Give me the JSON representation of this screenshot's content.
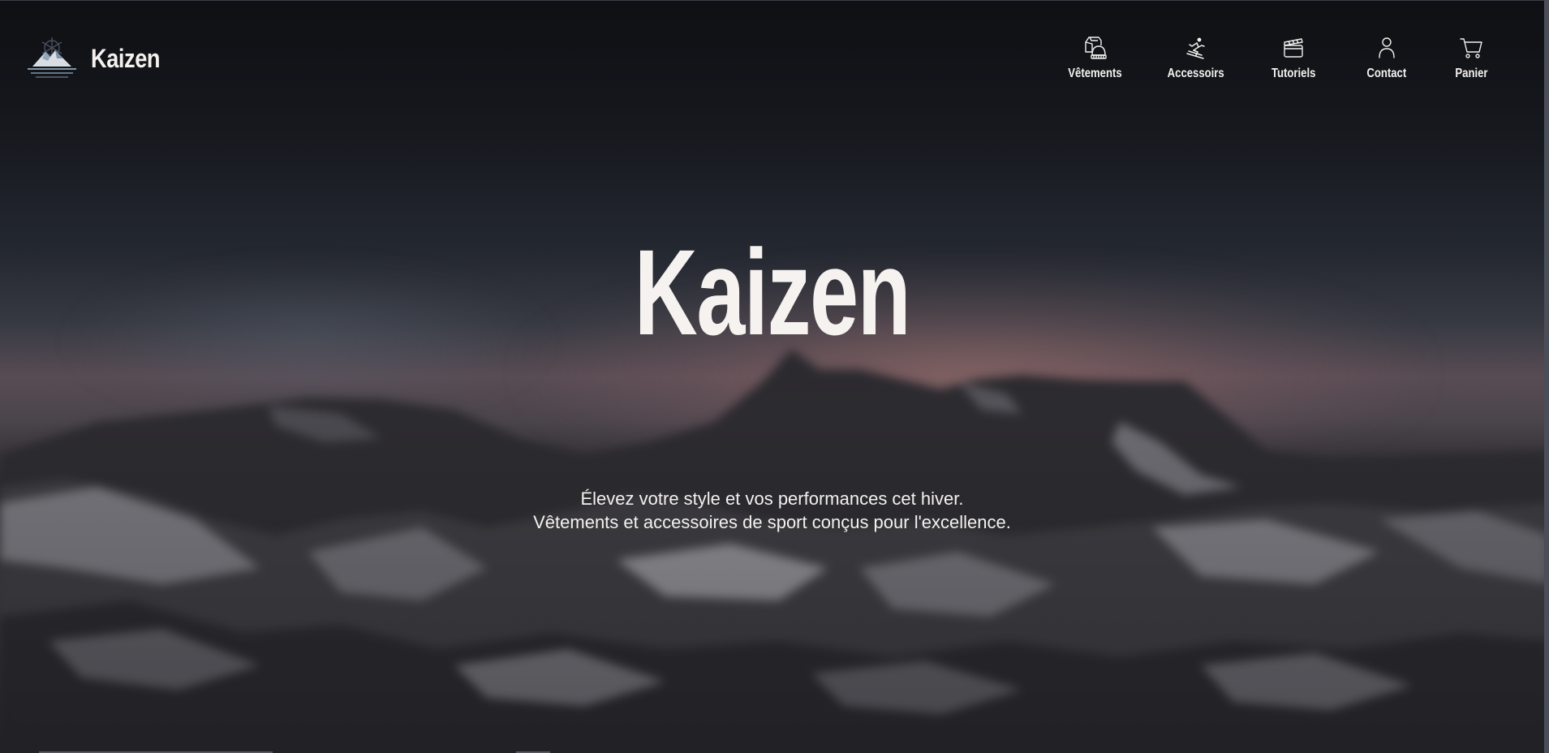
{
  "header": {
    "brand_name": "Kaizen",
    "logo_icon": "mountain-snowflake-logo",
    "nav": [
      {
        "label": "Vêtements",
        "icon": "clothing-icon"
      },
      {
        "label": "Accessoirs",
        "icon": "skier-icon"
      },
      {
        "label": "Tutoriels",
        "icon": "clapperboard-icon"
      },
      {
        "label": "Contact",
        "icon": "user-icon"
      },
      {
        "label": "Panier",
        "icon": "cart-icon"
      }
    ]
  },
  "hero": {
    "title": "Kaizen",
    "tagline_line1": "Élevez votre style et vos performances cet hiver.",
    "tagline_line2": "Vêtements et accessoires de sport conçus pour l'excellence."
  },
  "colors": {
    "text": "#f4f1ee",
    "background": "#15171c",
    "sky_glow": "#a9786f"
  }
}
